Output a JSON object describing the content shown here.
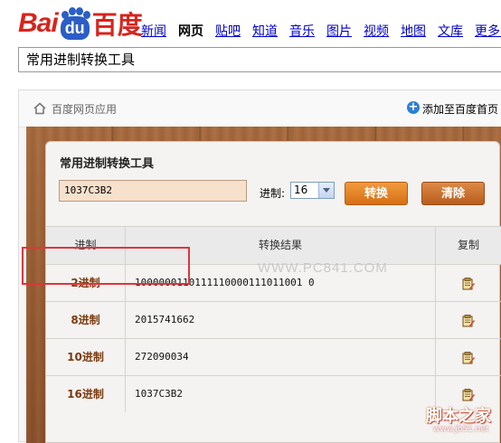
{
  "logo": {
    "text_bai": "Bai",
    "text_du": "du",
    "text_cn": "百度"
  },
  "nav": {
    "items": [
      {
        "label": "新闻",
        "active": false
      },
      {
        "label": "网页",
        "active": true
      },
      {
        "label": "贴吧",
        "active": false
      },
      {
        "label": "知道",
        "active": false
      },
      {
        "label": "音乐",
        "active": false
      },
      {
        "label": "图片",
        "active": false
      },
      {
        "label": "视频",
        "active": false
      },
      {
        "label": "地图",
        "active": false
      },
      {
        "label": "文库",
        "active": false
      },
      {
        "label": "更多»",
        "active": false
      }
    ]
  },
  "search": {
    "value": "常用进制转换工具"
  },
  "app_header": {
    "label": "百度网页应用",
    "add_home": "添加至百度首页"
  },
  "tool": {
    "title": "常用进制转换工具",
    "input_value": "1037C3B2",
    "base_label": "进制:",
    "base_selected": "16",
    "convert_label": "转换",
    "clear_label": "清除",
    "table": {
      "headers": [
        "进制",
        "转换结果",
        "复制"
      ],
      "rows": [
        {
          "base": "2进制",
          "result": "1000000110111110000111011001 0"
        },
        {
          "base": "8进制",
          "result": "2015741662"
        },
        {
          "base": "10进制",
          "result": "272090034"
        },
        {
          "base": "16进制",
          "result": "1037C3B2"
        }
      ]
    }
  },
  "watermark": "WWW.PC841.COM",
  "site_mark": {
    "cn": "脚本之家",
    "url": "www.jb51.net"
  },
  "colors": {
    "baidu_red": "#d7241c",
    "baidu_blue": "#2b5ec6",
    "link": "#0000cc",
    "convert_btn": "#e5851f",
    "clear_btn": "#c86d2a",
    "highlight": "#e0343c"
  }
}
